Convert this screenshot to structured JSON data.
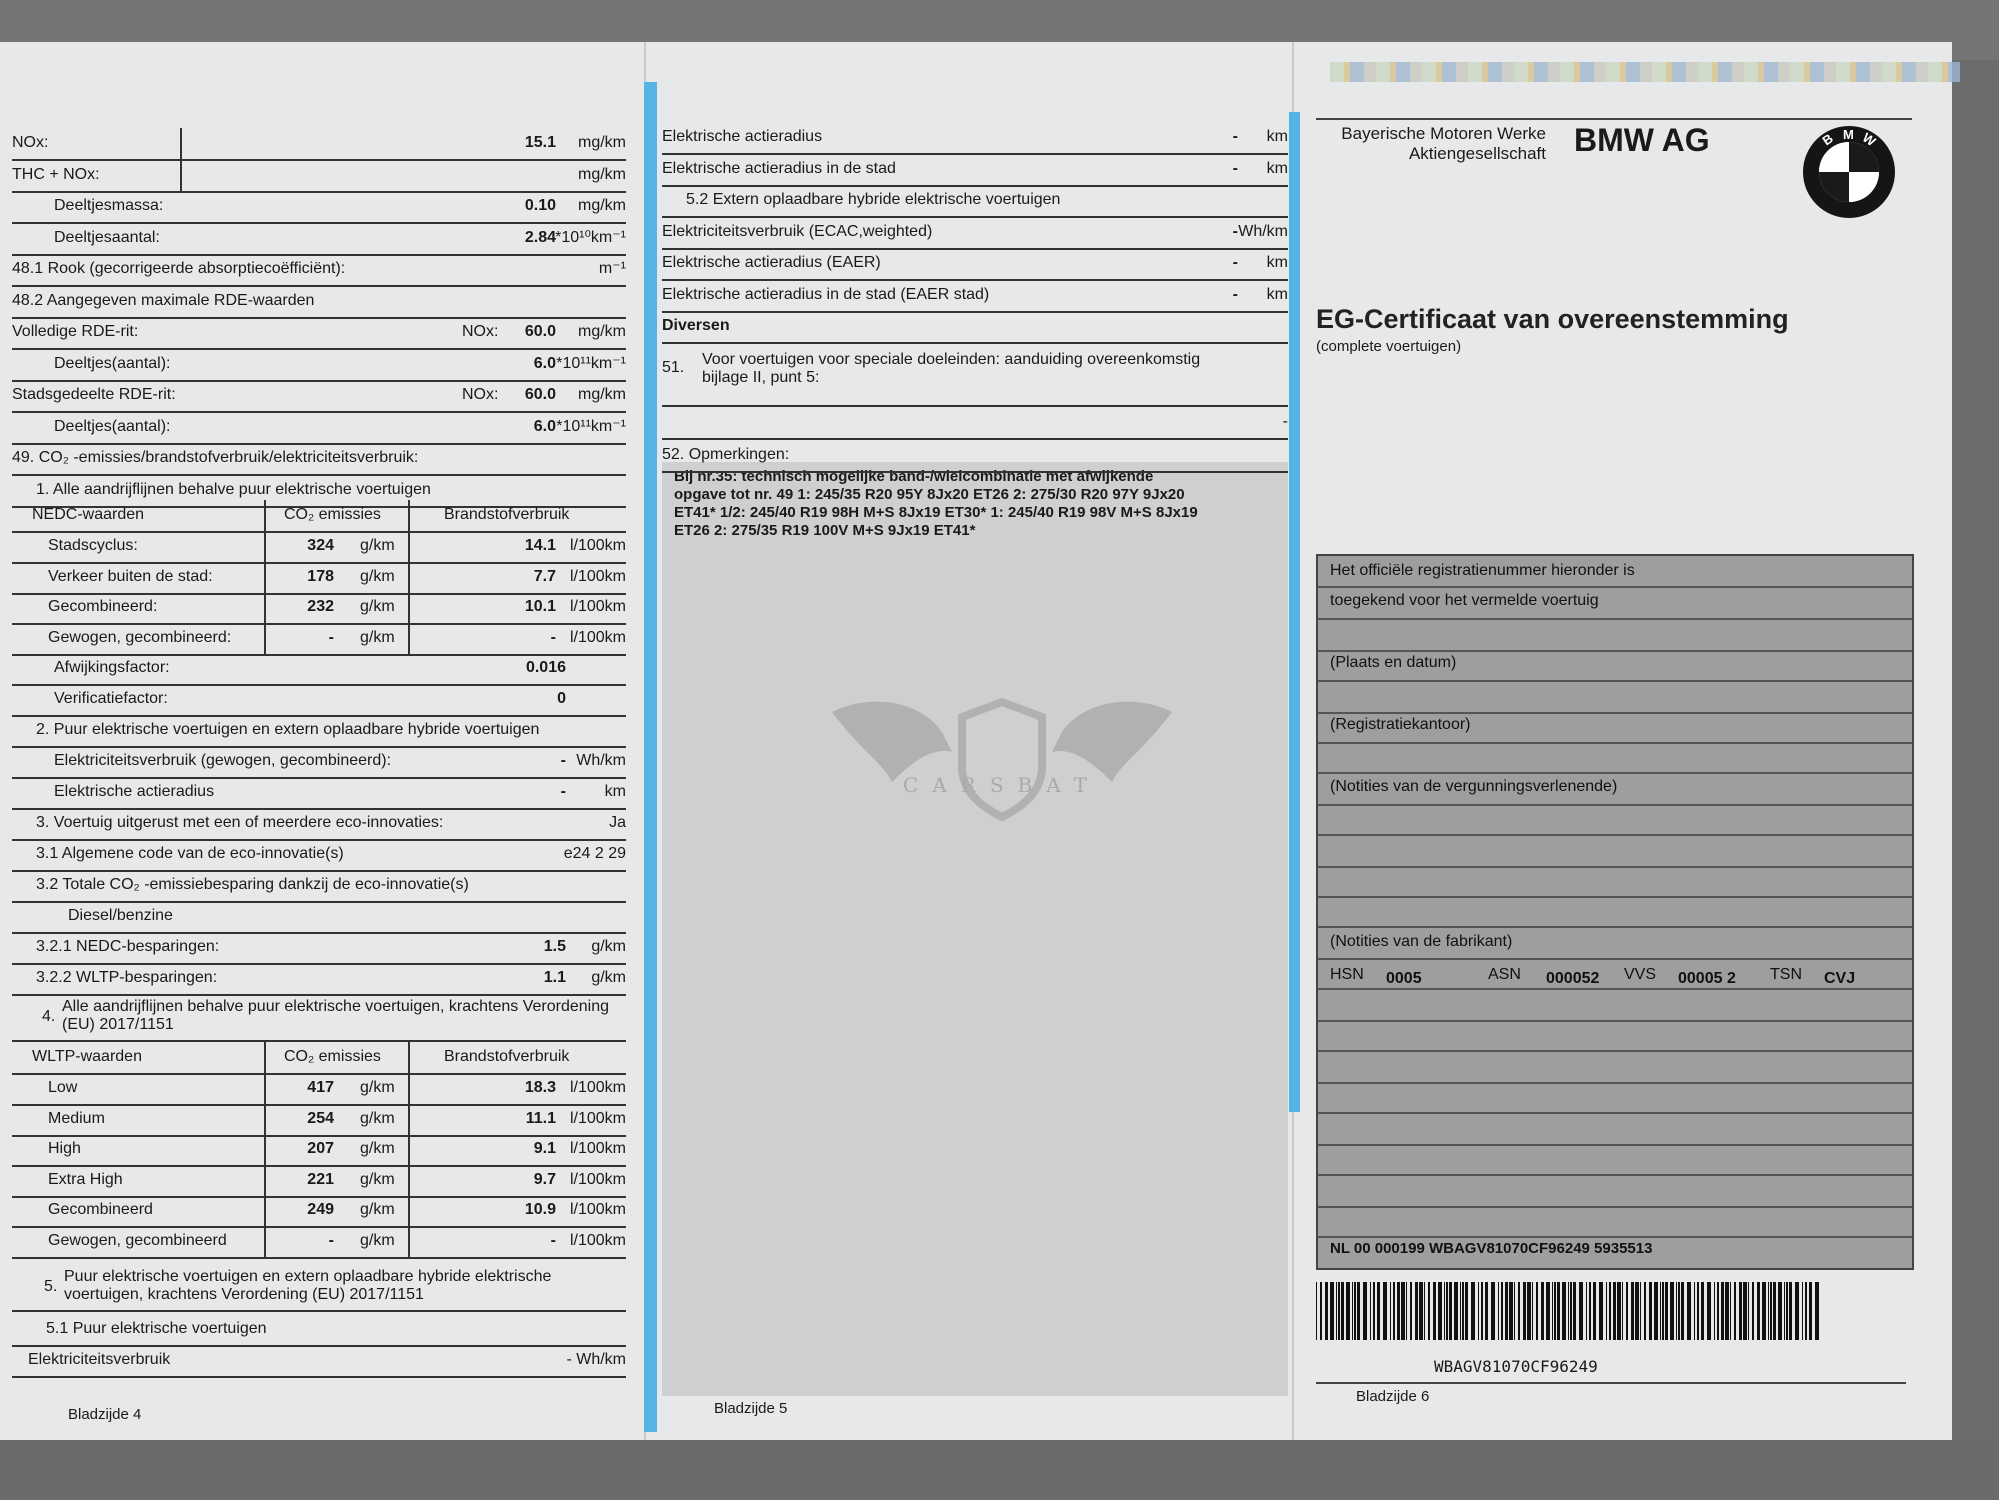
{
  "page4": {
    "rows": [
      {
        "label": "NOx:",
        "value": "15.1",
        "unit": "mg/km"
      },
      {
        "label": "THC + NOx:",
        "value": "",
        "unit": "mg/km"
      },
      {
        "label": "Deeltjesmassa:",
        "value": "0.10",
        "unit": "mg/km"
      },
      {
        "label": "Deeltjesaantal:",
        "value": "2.84",
        "unit": "*10¹⁰km⁻¹"
      },
      {
        "label": "48.1  Rook (gecorrigeerde absorptiecoëfficiënt):",
        "value": "",
        "unit": "m⁻¹"
      },
      {
        "label": "48.2  Aangegeven maximale RDE-waarden",
        "value": "",
        "unit": ""
      },
      {
        "label": "Volledige RDE-rit:",
        "sublabel": "NOx:",
        "value": "60.0",
        "unit": "mg/km"
      },
      {
        "label": "Deeltjes(aantal):",
        "value": "6.0",
        "unit": "*10¹¹km⁻¹"
      },
      {
        "label": "Stadsgedeelte RDE-rit:",
        "sublabel": "NOx:",
        "value": "60.0",
        "unit": "mg/km"
      },
      {
        "label": "Deeltjes(aantal):",
        "value": "6.0",
        "unit": "*10¹¹km⁻¹"
      },
      {
        "label": "49.   CO₂ -emissies/brandstofverbruik/elektriciteitsverbruik:",
        "value": "",
        "unit": ""
      },
      {
        "label": "1. Alle aandrijflijnen behalve puur elektrische voertuigen",
        "value": "",
        "unit": ""
      }
    ],
    "nedc": {
      "head": [
        "NEDC-waarden",
        "CO₂ emissies",
        "Brandstofverbruik"
      ],
      "rows": [
        {
          "label": "Stadscyclus:",
          "co2": "324",
          "co2_unit": "g/km",
          "fuel": "14.1",
          "fuel_unit": "l/100km"
        },
        {
          "label": "Verkeer buiten de stad:",
          "co2": "178",
          "co2_unit": "g/km",
          "fuel": "7.7",
          "fuel_unit": "l/100km"
        },
        {
          "label": "Gecombineerd:",
          "co2": "232",
          "co2_unit": "g/km",
          "fuel": "10.1",
          "fuel_unit": "l/100km"
        },
        {
          "label": "Gewogen, gecombineerd:",
          "co2": "-",
          "co2_unit": "g/km",
          "fuel": "-",
          "fuel_unit": "l/100km"
        }
      ]
    },
    "rows2": [
      {
        "label": "Afwijkingsfactor:",
        "value": "0.016",
        "unit": ""
      },
      {
        "label": "Verificatiefactor:",
        "value": "0",
        "unit": ""
      },
      {
        "label": "2. Puur elektrische voertuigen en extern oplaadbare hybride voertuigen",
        "value": "",
        "unit": ""
      },
      {
        "label": "Elektriciteitsverbruik (gewogen, gecombineerd):",
        "value": "-",
        "unit": "Wh/km"
      },
      {
        "label": "Elektrische actieradius",
        "value": "-",
        "unit": "km"
      },
      {
        "label": "3. Voertuig uitgerust met een of meerdere eco-innovaties:",
        "value": "",
        "unit": "Ja"
      },
      {
        "label": "3.1  Algemene code van de eco-innovatie(s)",
        "value": "",
        "unit": "e24 2 29"
      },
      {
        "label": "3.2  Totale CO₂ -emissiebesparing dankzij de eco-innovatie(s)",
        "value": "",
        "unit": ""
      },
      {
        "label": "Diesel/benzine",
        "value": "",
        "unit": ""
      },
      {
        "label": "3.2.1  NEDC-besparingen:",
        "value": "1.5",
        "unit": "g/km"
      },
      {
        "label": "3.2.2  WLTP-besparingen:",
        "value": "1.1",
        "unit": "g/km"
      }
    ],
    "item4_num": "4.",
    "item4": "Alle aandrijflijnen behalve puur elektrische voertuigen, krachtens Verordening\n(EU) 2017/1151",
    "wltp": {
      "head": [
        "WLTP-waarden",
        "CO₂ emissies",
        "Brandstofverbruik"
      ],
      "rows": [
        {
          "label": "Low",
          "co2": "417",
          "co2_unit": "g/km",
          "fuel": "18.3",
          "fuel_unit": "l/100km"
        },
        {
          "label": "Medium",
          "co2": "254",
          "co2_unit": "g/km",
          "fuel": "11.1",
          "fuel_unit": "l/100km"
        },
        {
          "label": "High",
          "co2": "207",
          "co2_unit": "g/km",
          "fuel": "9.1",
          "fuel_unit": "l/100km"
        },
        {
          "label": "Extra High",
          "co2": "221",
          "co2_unit": "g/km",
          "fuel": "9.7",
          "fuel_unit": "l/100km"
        },
        {
          "label": "Gecombineerd",
          "co2": "249",
          "co2_unit": "g/km",
          "fuel": "10.9",
          "fuel_unit": "l/100km"
        },
        {
          "label": "Gewogen, gecombineerd",
          "co2": "-",
          "co2_unit": "g/km",
          "fuel": "-",
          "fuel_unit": "l/100km"
        }
      ]
    },
    "item5_num": "5.",
    "item5": "Puur elektrische voertuigen en extern oplaadbare hybride elektrische\nvoertuigen, krachtens Verordening (EU) 2017/1151",
    "item51": "5.1  Puur elektrische voertuigen",
    "last_label": "Elektriciteitsverbruik",
    "last_value": "- Wh/km",
    "page_label": "Bladzijde 4"
  },
  "page5": {
    "rows": [
      {
        "label": "Elektrische actieradius",
        "value": "-",
        "unit": "km"
      },
      {
        "label": "Elektrische actieradius in de stad",
        "value": "-",
        "unit": "km"
      },
      {
        "label": "5.2  Extern oplaadbare hybride elektrische voertuigen",
        "value": "",
        "unit": ""
      },
      {
        "label": "Elektriciteitsverbruik (ECAC,weighted)",
        "value": "-",
        "unit": "Wh/km"
      },
      {
        "label": "Elektrische actieradius (EAER)",
        "value": "-",
        "unit": "km"
      },
      {
        "label": "Elektrische actieradius in de stad (EAER stad)",
        "value": "-",
        "unit": "km"
      },
      {
        "label": "Diversen",
        "value": "",
        "unit": ""
      }
    ],
    "item51_num": "51.",
    "item51": "Voor voertuigen voor speciale doeleinden: aanduiding overeenkomstig\nbijlage II, punt 5:",
    "item51_value": "-",
    "item52": "52.   Opmerkingen:",
    "remarks": "Bij nr.35: technisch mogelijke band-/wielcombinatie met afwijkende\nopgave tot nr. 49  1: 245/35 R20 95Y 8Jx20 ET26 2: 275/30 R20 97Y 9Jx20\nET41*  1/2: 245/40 R19 98H M+S 8Jx19 ET30*  1: 245/40 R19 98V M+S 8Jx19\nET26 2: 275/35 R19 100V M+S 9Jx19 ET41*",
    "watermark": "CARSBAT",
    "page_label": "Bladzijde 5"
  },
  "page6": {
    "company_line1": "Bayerische Motoren Werke",
    "company_line2": "Aktiengesellschaft",
    "brand": "BMW AG",
    "logo_letters": [
      "B",
      "M",
      "W"
    ],
    "title": "EG-Certificaat van overeenstemming",
    "subtitle": "(complete voertuigen)",
    "reg_line1": "Het officiële registratienummer hieronder is",
    "reg_line2": "toegekend voor het vermelde voertuig",
    "place_date": "(Plaats en datum)",
    "reg_office": "(Registratiekantoor)",
    "notes_authority": "(Notities van de vergunningsverlenende)",
    "notes_manufacturer": "(Notities van de fabrikant)",
    "hsn_label": "HSN",
    "hsn": "0005",
    "asn_label": "ASN",
    "asn": "000052",
    "vvs_label": "VVS",
    "vvs": "00005 2",
    "tsn_label": "TSN",
    "tsn": "CVJ",
    "reg_number": "NL 00 000199 WBAGV81070CF96249 5935513",
    "vin": "WBAGV81070CF96249",
    "page_label": "Bladzijde 6"
  },
  "colors": {
    "accent_blue": "#55b4e4",
    "paper": "#e6e8ea",
    "box_gray": "#9c9ea0"
  }
}
